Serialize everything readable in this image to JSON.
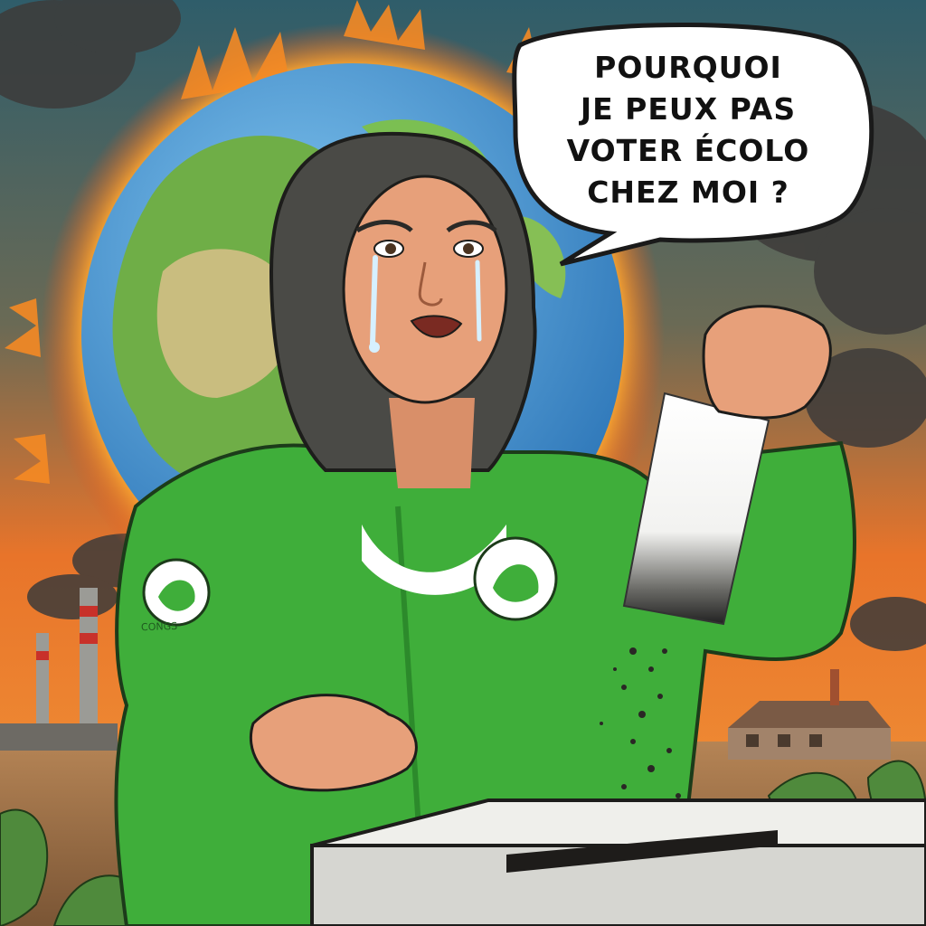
{
  "speech_bubble": {
    "lines": [
      "POURQUOI",
      "JE PEUX PAS",
      "VOTER ÉCOLO",
      "CHEZ MOI ?"
    ]
  },
  "sleeve_logo_text": "CONGS",
  "scene": {
    "elements": [
      "burning-earth",
      "crying-woman",
      "green-hoodie",
      "ballot-paper-crumbling",
      "ballot-box",
      "smokestacks",
      "smoke-plumes",
      "farmhouse",
      "leaves"
    ]
  },
  "colors": {
    "sky_orange": "#e8742a",
    "sky_teal": "#2f5d6a",
    "fire": "#f7a531",
    "ocean": "#3a8fd1",
    "land": "#6fae47",
    "hoodie": "#3fae3a",
    "hoodie_shadow": "#2c8a2b",
    "skin": "#e7a07a",
    "hair": "#4a4a46",
    "ballot_box": "#e6e6e2"
  }
}
